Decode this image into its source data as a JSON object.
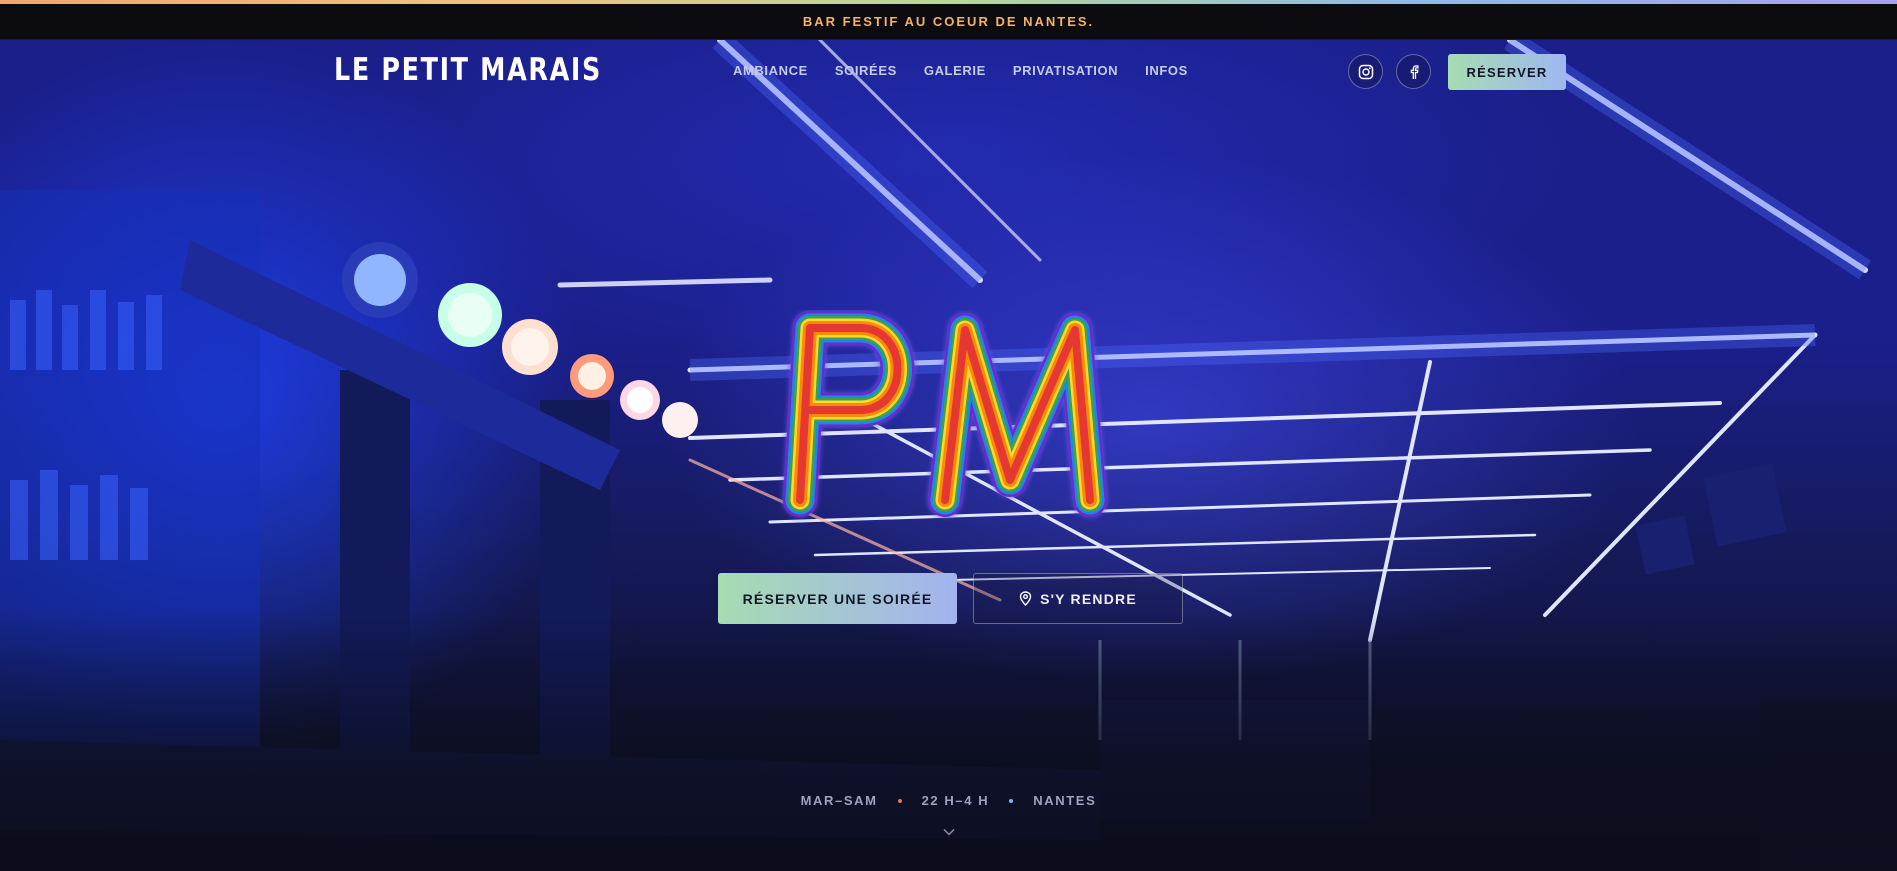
{
  "topbar": {
    "announcement": "BAR FESTIF AU COEUR DE NANTES."
  },
  "nav": {
    "logo": "LE PETIT MARAIS",
    "menu": [
      "AMBIANCE",
      "SOIRÉES",
      "GALERIE",
      "PRIVATISATION",
      "INFOS"
    ],
    "reserve_label": "RÉSERVER",
    "social": [
      "instagram-icon",
      "facebook-icon"
    ]
  },
  "hero": {
    "neon_text": "PM",
    "primary_cta": "RÉSERVER UNE SOIRÉE",
    "secondary_cta": "S'Y RENDRE",
    "info": [
      "MAR–SAM",
      "22 H–4 H",
      "NANTES"
    ],
    "dot_colors": [
      "#e8736a",
      "#8fb0ee"
    ]
  },
  "colors": {
    "accent_gradient": [
      "#a6dcb2",
      "#9fb7f0"
    ],
    "announcement": "#f2b36a",
    "rainbow": [
      "#e53935",
      "#fb8c00",
      "#fdd835",
      "#43a047",
      "#1e88e5",
      "#8e24aa"
    ]
  }
}
